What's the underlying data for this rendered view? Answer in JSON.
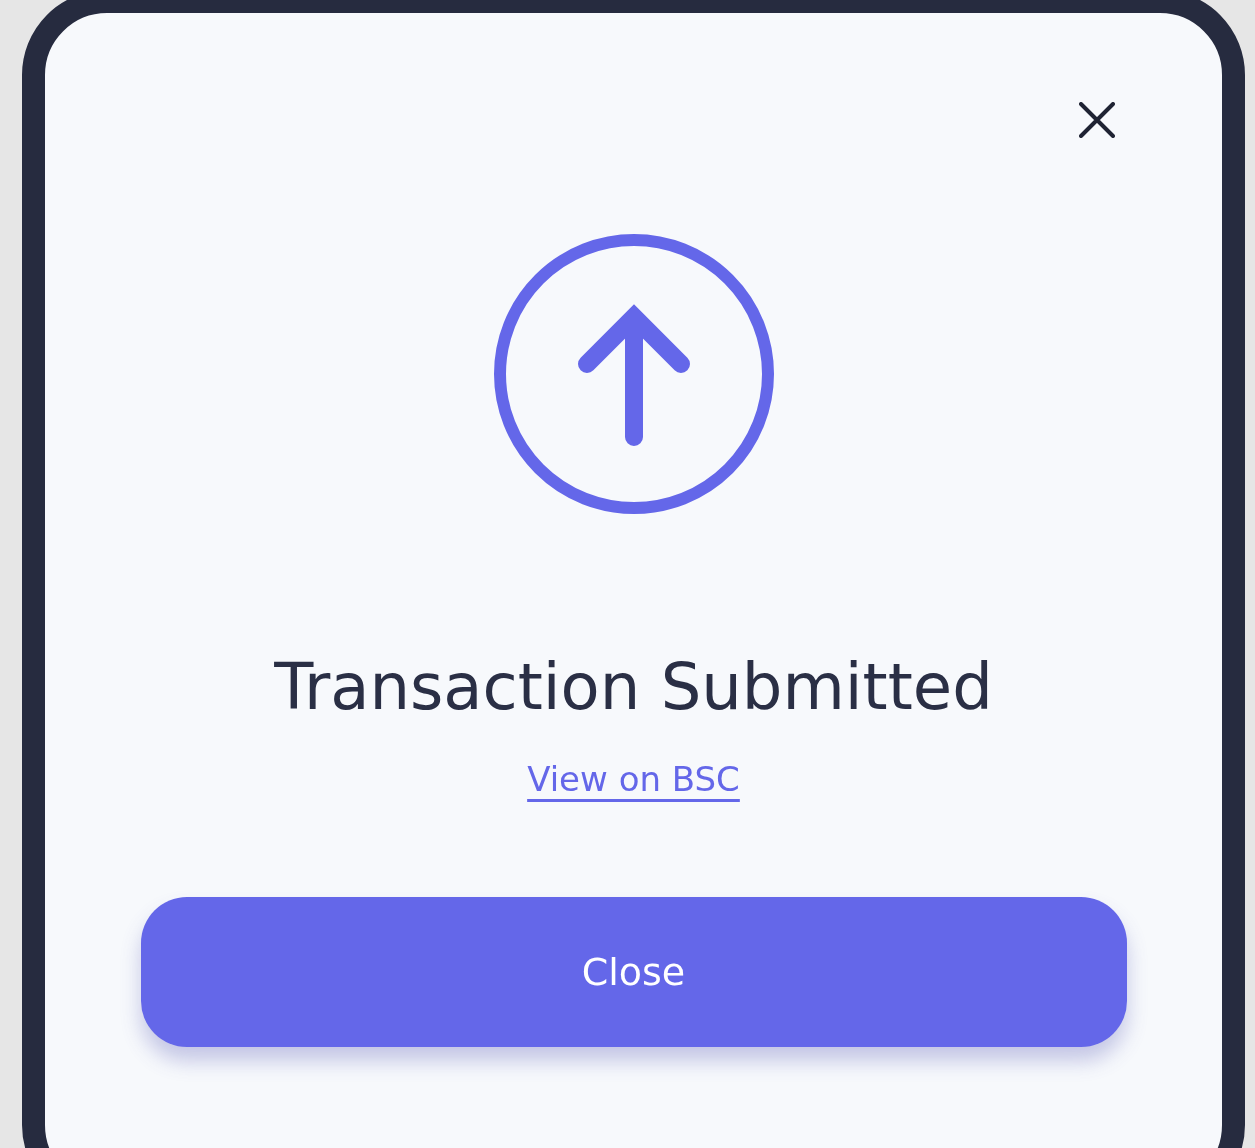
{
  "dialog": {
    "title": "Transaction Submitted",
    "link": "View on BSC",
    "button": "Close"
  }
}
